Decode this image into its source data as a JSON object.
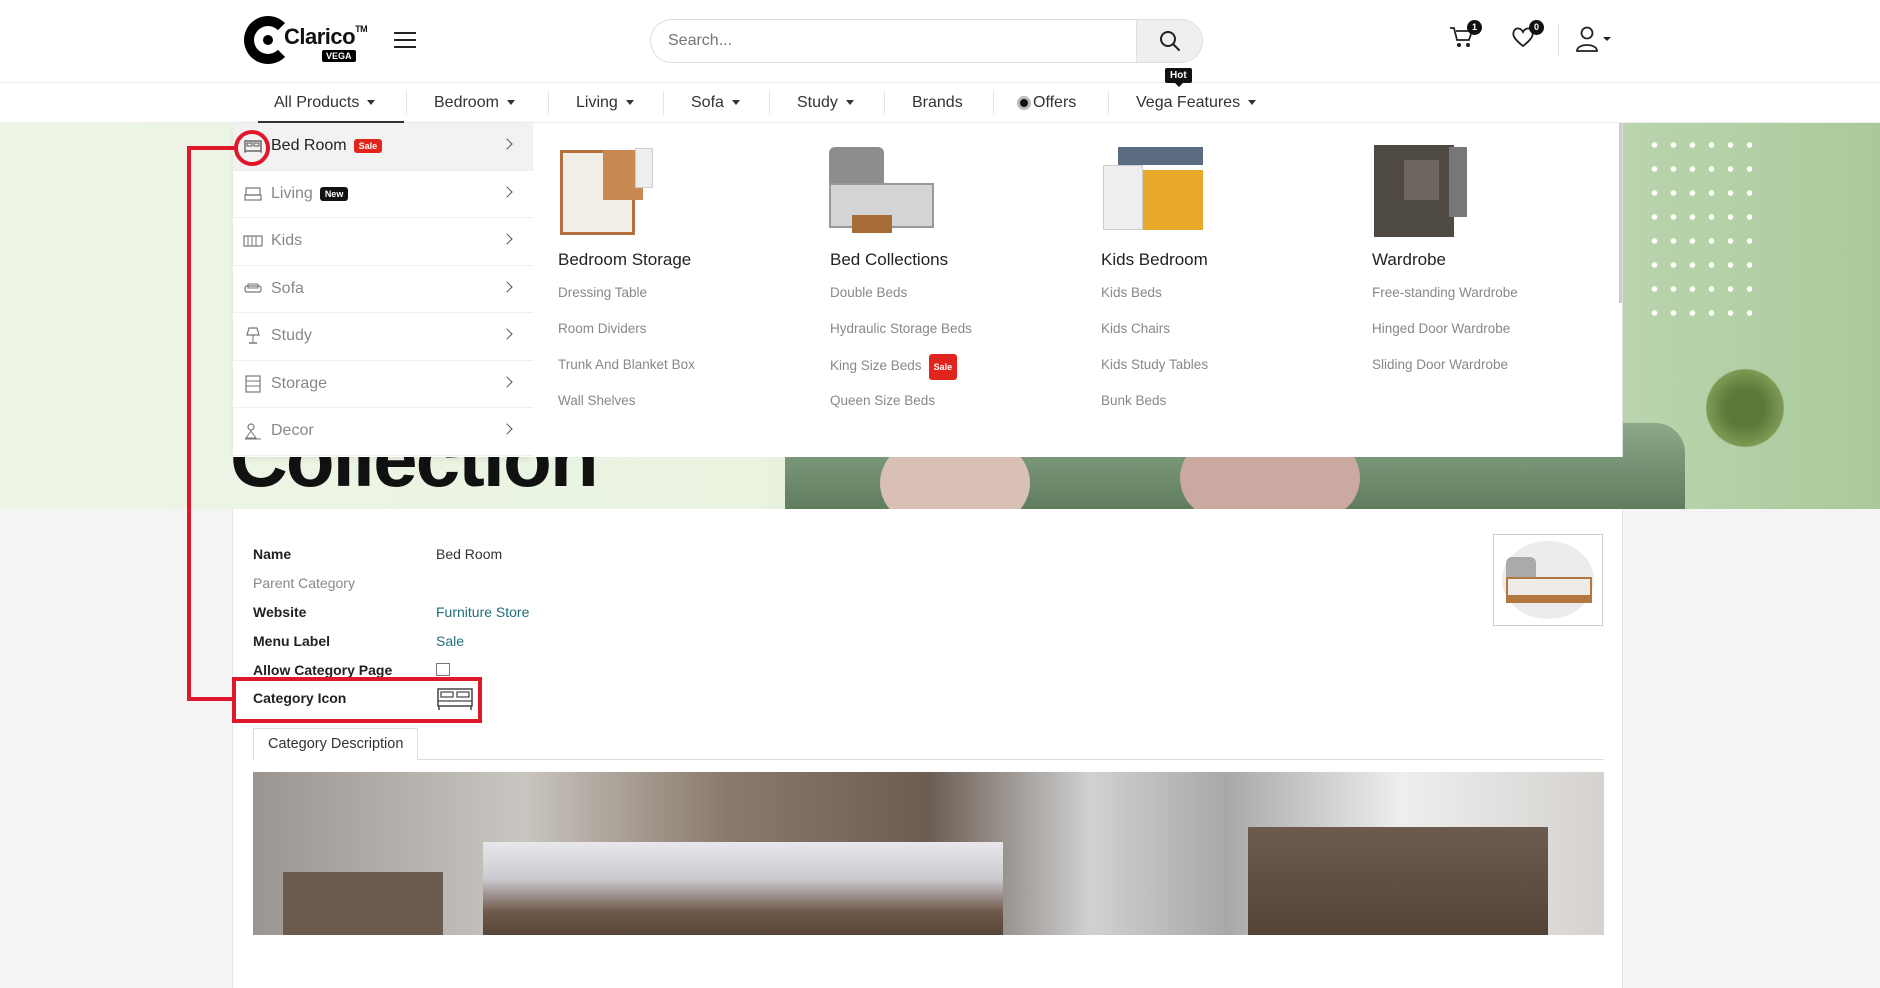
{
  "brand": {
    "name": "Clarico",
    "tm": "TM",
    "sub": "VEGA"
  },
  "search": {
    "placeholder": "Search..."
  },
  "header": {
    "cart_count": "1",
    "wishlist_count": "0"
  },
  "nav": {
    "items": [
      {
        "label": "All Products"
      },
      {
        "label": "Bedroom"
      },
      {
        "label": "Living"
      },
      {
        "label": "Sofa"
      },
      {
        "label": "Study"
      },
      {
        "label": "Brands"
      },
      {
        "label": "Offers"
      },
      {
        "label": "Vega Features"
      }
    ],
    "hot_label": "Hot"
  },
  "hero": {
    "title": "Collection"
  },
  "menu": {
    "categories": [
      {
        "label": "Bed Room",
        "tag": "Sale",
        "icon": "bed-icon"
      },
      {
        "label": "Living",
        "tag": "New",
        "icon": "living-icon"
      },
      {
        "label": "Kids",
        "icon": "crib-icon"
      },
      {
        "label": "Sofa",
        "icon": "sofa-icon"
      },
      {
        "label": "Study",
        "icon": "lamp-icon"
      },
      {
        "label": "Storage",
        "icon": "cabinet-icon"
      },
      {
        "label": "Decor",
        "icon": "decor-icon"
      }
    ],
    "columns": [
      {
        "title": "Bedroom Storage",
        "links": [
          "Dressing Table",
          "Room Dividers",
          "Trunk And Blanket Box",
          "Wall Shelves"
        ]
      },
      {
        "title": "Bed Collections",
        "links": [
          "Double Beds",
          "Hydraulic Storage Beds",
          "King Size Beds",
          "Queen Size Beds"
        ],
        "sale_tag": "Sale"
      },
      {
        "title": "Kids Bedroom",
        "links": [
          "Kids Beds",
          "Kids Chairs",
          "Kids Study Tables",
          "Bunk Beds"
        ]
      },
      {
        "title": "Wardrobe",
        "links": [
          "Free-standing Wardrobe",
          "Hinged Door Wardrobe",
          "Sliding Door Wardrobe"
        ]
      }
    ]
  },
  "form": {
    "name_label": "Name",
    "name_value": "Bed Room",
    "parent_label": "Parent Category",
    "website_label": "Website",
    "website_value": "Furniture Store",
    "menu_label_label": "Menu Label",
    "menu_label_value": "Sale",
    "allow_label": "Allow Category Page",
    "icon_label": "Category Icon",
    "tab_label": "Category Description"
  },
  "colors": {
    "highlight": "#e0162b",
    "sale": "#e2251c",
    "link": "#1f6f7a"
  }
}
